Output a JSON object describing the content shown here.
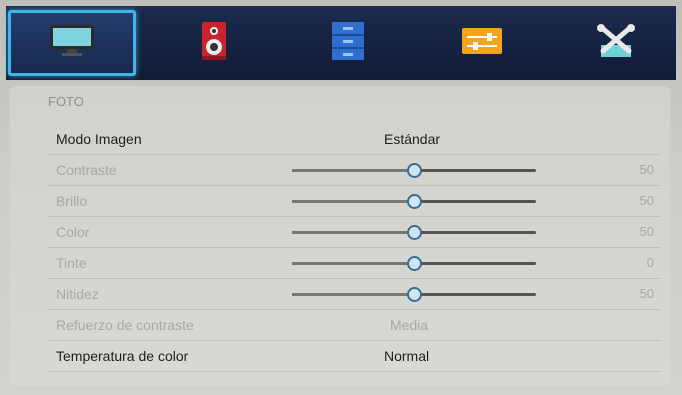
{
  "tabs": [
    {
      "name": "picture",
      "icon": "monitor-icon",
      "active": true
    },
    {
      "name": "sound",
      "icon": "speaker-icon",
      "active": false
    },
    {
      "name": "channel",
      "icon": "storage-icon",
      "active": false
    },
    {
      "name": "settings",
      "icon": "sliders-icon",
      "active": false
    },
    {
      "name": "tools",
      "icon": "tools-icon",
      "active": false
    }
  ],
  "section": {
    "title": "FOTO"
  },
  "rows": {
    "picture_mode": {
      "label": "Modo Imagen",
      "value": "Estándar"
    },
    "contrast": {
      "label": "Contraste",
      "value": "50",
      "level": 0.5
    },
    "brightness": {
      "label": "Brillo",
      "value": "50",
      "level": 0.5
    },
    "color": {
      "label": "Color",
      "value": "50",
      "level": 0.5
    },
    "tint": {
      "label": "Tinte",
      "value": "0",
      "level": 0.5
    },
    "sharpness": {
      "label": "Nitidez",
      "value": "50",
      "level": 0.5
    },
    "contrast_boost": {
      "label": "Refuerzo de contraste",
      "value": "Media"
    },
    "color_temperature": {
      "label": "Temperatura de color",
      "value": "Normal"
    }
  },
  "colors": {
    "accent": "#3fb6e8",
    "bar_bg": "#111b37"
  }
}
